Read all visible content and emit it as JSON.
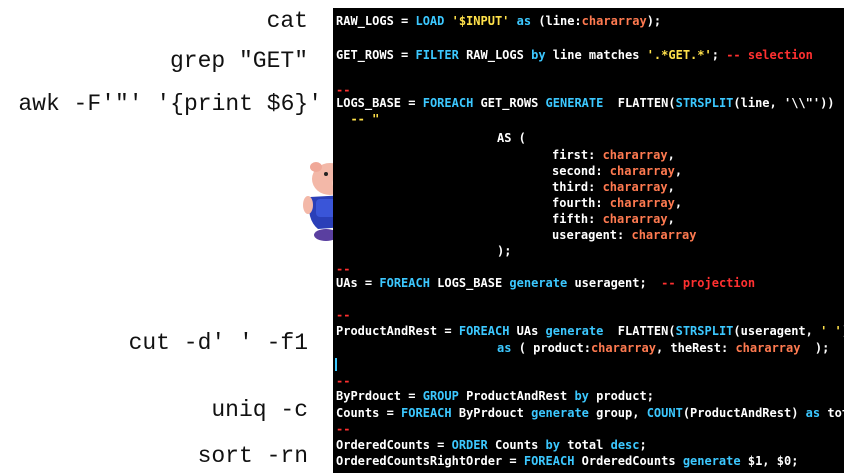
{
  "shell": [
    "cat",
    "grep \"GET\"",
    "awk -F'\"' '{print $6}'",
    "cut -d' ' -f1",
    "uniq -c",
    "sort -rn"
  ],
  "code": {
    "l1": {
      "a": "RAW_LOGS",
      "b": " = ",
      "c": "LOAD ",
      "d": "'$INPUT'",
      "e": " as ",
      "f": "(line:",
      "g": "chararray",
      "h": ");"
    },
    "l2": {
      "a": "GET_ROWS",
      "b": " = ",
      "c": "FILTER ",
      "d": "RAW_LOGS ",
      "e": "by ",
      "f": "line matches ",
      "g": "'.*GET.*'",
      "h": "; ",
      "i": "-- selection"
    },
    "l3": "--",
    "l4": {
      "a": "LOGS_BASE",
      "b": " = ",
      "c": "FOREACH ",
      "d": "GET_ROWS ",
      "e": "GENERATE  ",
      "f": "FLATTEN(",
      "g": "STRSPLIT",
      "h": "(line, '\\\\\"'))"
    },
    "l5": "  -- \"",
    "l6": "AS (",
    "fields": [
      {
        "n": "first: ",
        "t": "chararray",
        "p": ","
      },
      {
        "n": "second: ",
        "t": "chararray",
        "p": ","
      },
      {
        "n": "third: ",
        "t": "chararray",
        "p": ","
      },
      {
        "n": "fourth: ",
        "t": "chararray",
        "p": ","
      },
      {
        "n": "fifth: ",
        "t": "chararray",
        "p": ","
      },
      {
        "n": "useragent: ",
        "t": "chararray",
        "p": ""
      }
    ],
    "l13": ");",
    "l14": "--",
    "l15": {
      "a": "UAs",
      "b": " = ",
      "c": "FOREACH ",
      "d": "LOGS_BASE ",
      "e": "generate ",
      "f": "useragent;  ",
      "g": "-- projection"
    },
    "l16": "--",
    "l17": {
      "a": "ProductAndRest",
      "b": " = ",
      "c": "FOREACH ",
      "d": "UAs ",
      "e": "generate  ",
      "f": "FLATTEN(",
      "g": "STRSPLIT",
      "h": "(useragent, ",
      "i": "' '",
      "j": "))"
    },
    "l18": {
      "a": "as ",
      "b": "( product:",
      "c": "chararray",
      ",d": "",
      "d": ", theRest: ",
      "e": "chararray",
      "f": "  );"
    },
    "l19": "--",
    "l20": {
      "a": "ByPrdouct",
      "b": " = ",
      "c": "GROUP ",
      "d": "ProductAndRest ",
      "e": "by ",
      "f": "product;"
    },
    "l21": {
      "a": "Counts",
      "b": " = ",
      "c": "FOREACH ",
      "d": "ByPrdouct ",
      "e": "generate ",
      "f": "group, ",
      "g": "COUNT",
      "h": "(ProductAndRest) ",
      "i": "as ",
      "j": "total;"
    },
    "l22": "--",
    "l23": {
      "a": "OrderedCounts",
      "b": " = ",
      "c": "ORDER ",
      "d": "Counts ",
      "e": "by ",
      "f": "total ",
      "g": "desc",
      ";": "",
      "h": ";"
    },
    "l24": {
      "a": "OrderedCountsRightOrder",
      "b": " = ",
      "c": "FOREACH ",
      "d": "OrderedCounts ",
      "e": "generate ",
      "f": "$1, $0;"
    }
  },
  "colors": {
    "background": "#000000",
    "keyword": "#3cc8ff",
    "type": "#ff7a50",
    "string": "#ffe14a",
    "comment": "#ff3030"
  },
  "mascot": "pig-mascot-icon"
}
